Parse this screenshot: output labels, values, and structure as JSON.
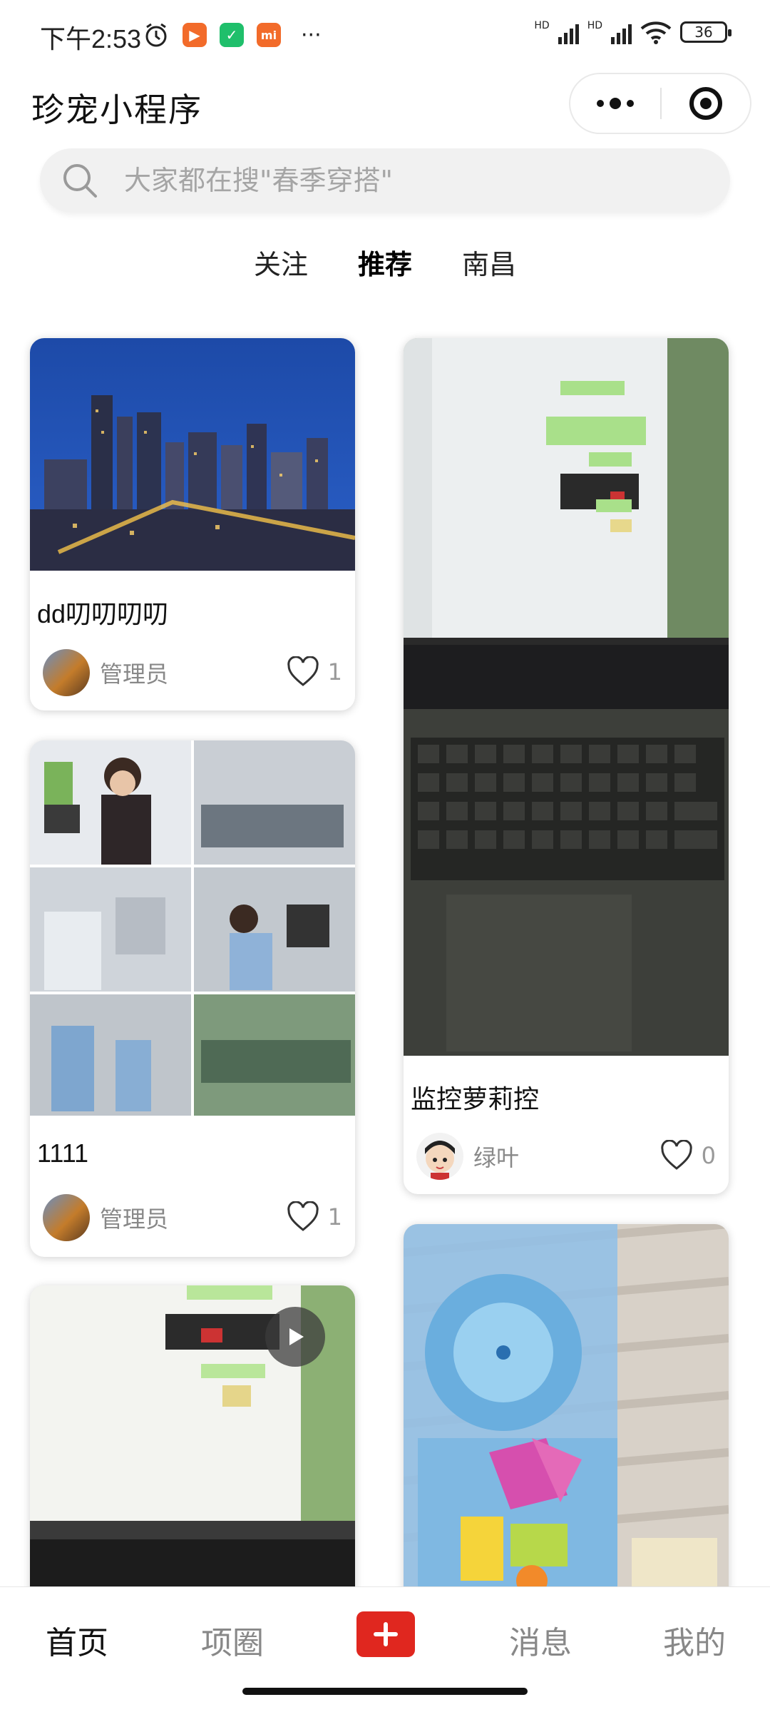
{
  "status": {
    "time": "下午2:53",
    "hd1": "HD",
    "hd2": "HD",
    "battery": "36"
  },
  "header": {
    "title": "珍宠小程序"
  },
  "search": {
    "placeholder": "大家都在搜\"春季穿搭\""
  },
  "tabs": [
    {
      "label": "关注",
      "active": false
    },
    {
      "label": "推荐",
      "active": true
    },
    {
      "label": "南昌",
      "active": false
    }
  ],
  "feed": {
    "left": [
      {
        "title": "dd叨叨叨叨",
        "author": "管理员",
        "likes": "1",
        "image": "city-night-skyline"
      },
      {
        "title": "1111",
        "author": "管理员",
        "likes": "1",
        "image": "factory-collage"
      },
      {
        "title": "",
        "author": "",
        "likes": "",
        "image": "laptop-chat-video"
      }
    ],
    "right": [
      {
        "title": "监控萝莉控",
        "author": "绿叶",
        "likes": "0",
        "image": "laptop-chat-screen"
      },
      {
        "title": "",
        "author": "",
        "likes": "",
        "image": "blue-toy-case"
      }
    ]
  },
  "bottom_nav": {
    "items": [
      {
        "label": "首页",
        "active": true
      },
      {
        "label": "项圈",
        "active": false
      },
      {
        "label": "消息",
        "active": false
      },
      {
        "label": "我的",
        "active": false
      }
    ]
  },
  "colors": {
    "accent": "#e0271f",
    "text": "#111111",
    "muted": "#888888"
  }
}
